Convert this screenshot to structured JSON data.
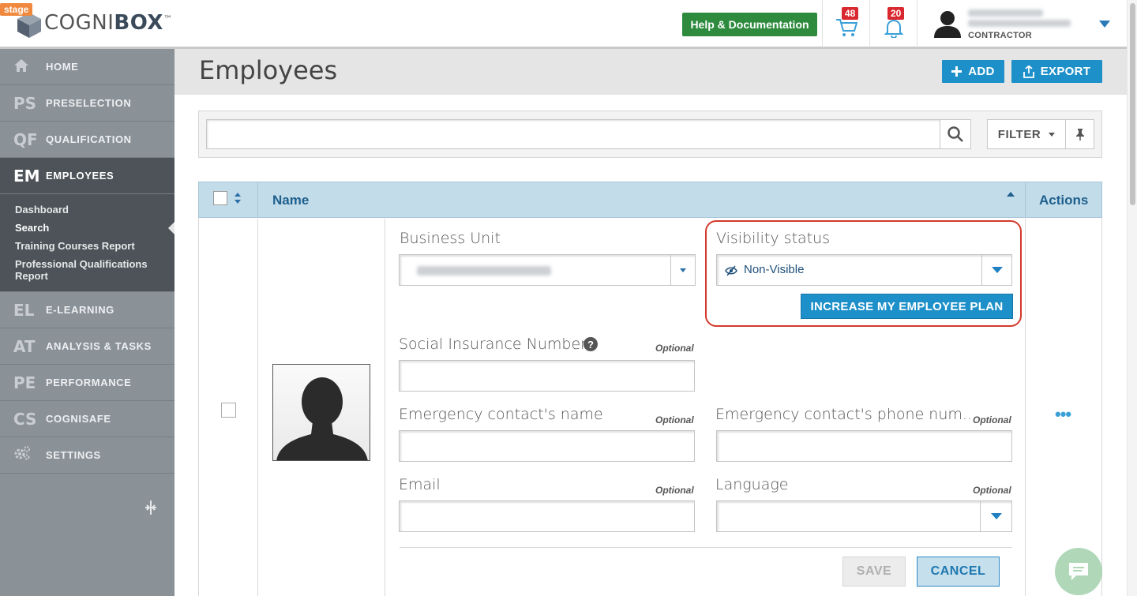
{
  "header": {
    "stage_badge": "stage",
    "logo_part1": "COGNI",
    "logo_part2": "BOX",
    "logo_tm": "™",
    "help_button": "Help & Documentation",
    "cart_count": "48",
    "notifications_count": "20",
    "user_role": "CONTRACTOR",
    "icons": [
      "cart-icon",
      "bell-icon",
      "user-avatar-icon",
      "caret-down-icon"
    ]
  },
  "sidebar": {
    "items": [
      {
        "abbr": "",
        "label": "HOME",
        "icon": "home-icon"
      },
      {
        "abbr": "PS",
        "label": "PRESELECTION"
      },
      {
        "abbr": "QF",
        "label": "QUALIFICATION"
      },
      {
        "abbr": "EM",
        "label": "EMPLOYEES",
        "active": true
      },
      {
        "abbr": "EL",
        "label": "E-LEARNING"
      },
      {
        "abbr": "AT",
        "label": "ANALYSIS & TASKS"
      },
      {
        "abbr": "PE",
        "label": "PERFORMANCE"
      },
      {
        "abbr": "CS",
        "label": "COGNISAFE"
      },
      {
        "abbr": "",
        "label": "SETTINGS",
        "icon": "gears-icon"
      }
    ],
    "subitems": [
      {
        "label": "Dashboard"
      },
      {
        "label": "Search",
        "current": true
      },
      {
        "label": "Training Courses Report"
      },
      {
        "label": "Professional Qualifications Report"
      }
    ]
  },
  "main": {
    "title": "Employees",
    "add_button": "ADD",
    "export_button": "EXPORT",
    "search_placeholder": "",
    "filter_button": "FILTER"
  },
  "table": {
    "columns": {
      "name": "Name",
      "actions": "Actions"
    },
    "row_actions_glyph": "•••"
  },
  "form": {
    "business_unit_label": "Business Unit",
    "visibility_label": "Visibility status",
    "visibility_value": "Non-Visible",
    "increase_plan_button": "INCREASE MY EMPLOYEE PLAN",
    "sin_label": "Social Insurance Number",
    "help_glyph": "?",
    "optional": "Optional",
    "emergency_name_label": "Emergency contact's name",
    "emergency_phone_label": "Emergency contact's phone num...",
    "email_label": "Email",
    "language_label": "Language",
    "save_button": "SAVE",
    "cancel_button": "CANCEL"
  },
  "colors": {
    "primary_blue": "#1e90c9",
    "help_green": "#2e8b3e",
    "badge_red": "#d9282f",
    "highlight_red": "#d33a2c",
    "sidebar_gray": "#8a9197",
    "sidebar_active": "#4d5358",
    "table_header_blue": "#c3dcea"
  }
}
